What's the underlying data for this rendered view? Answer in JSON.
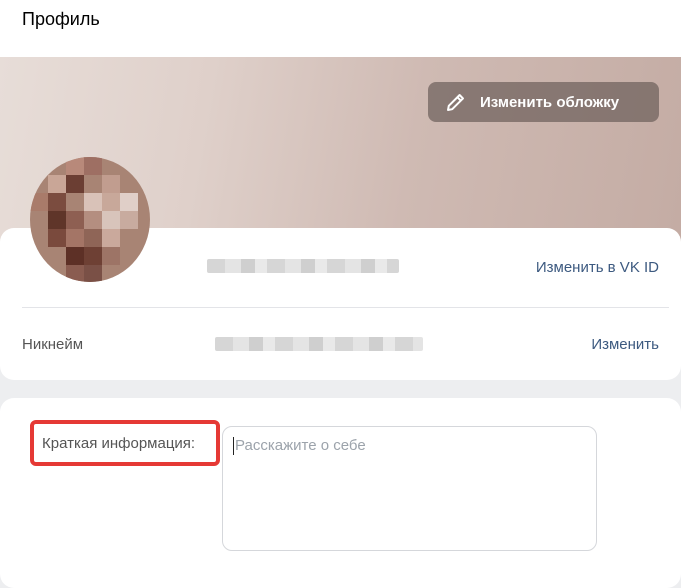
{
  "header": {
    "title": "Профиль"
  },
  "cover": {
    "edit_cover_label": "Изменить обложку"
  },
  "profile": {
    "edit_vkid_label": "Изменить в VK ID",
    "nickname_label": "Никнейм",
    "nickname_edit_label": "Изменить"
  },
  "about": {
    "label": "Краткая информация:",
    "placeholder": "Расскажите о себе",
    "value": ""
  },
  "colors": {
    "highlight": "#e53935",
    "link": "#3d5a80"
  }
}
